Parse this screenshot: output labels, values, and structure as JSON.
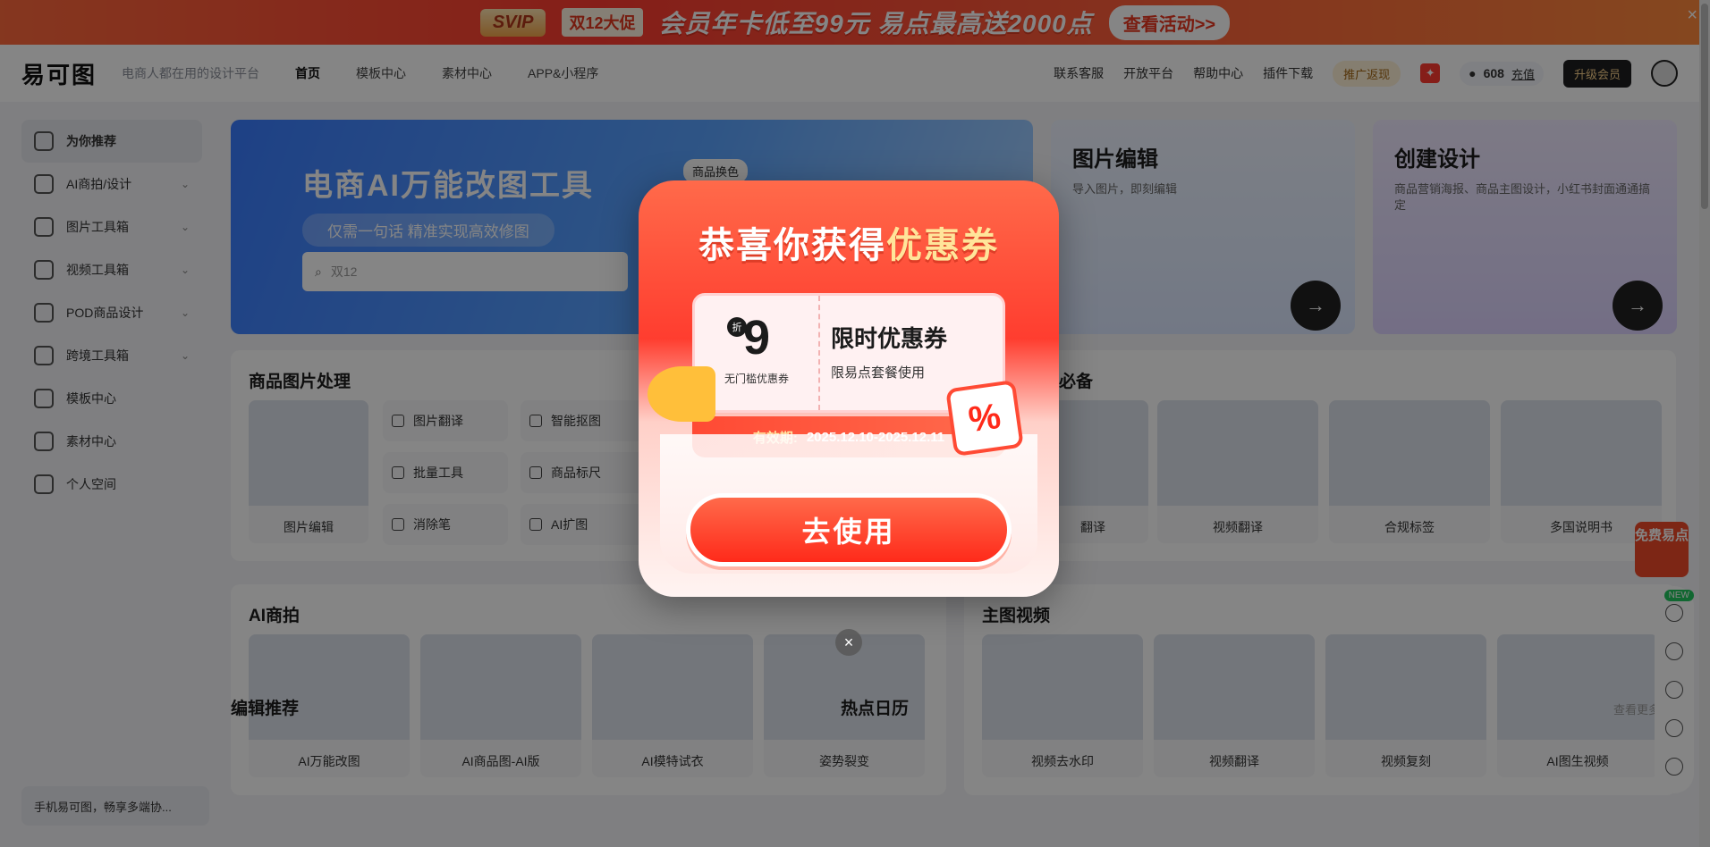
{
  "promo_banner": {
    "badge": "SVIP",
    "event_tag": "双12大促",
    "text": "会员年卡低至99元 易点最高送2000点",
    "cta": "查看活动>>",
    "close": "×"
  },
  "header": {
    "logo": "易可图",
    "slogan": "电商人都在用的设计平台",
    "nav": [
      "首页",
      "模板中心",
      "素材中心",
      "APP&小程序"
    ],
    "links": [
      "联系客服",
      "开放平台",
      "帮助中心",
      "插件下载"
    ],
    "promo_return": "推广返现",
    "points": "608",
    "recharge": "充值",
    "upgrade": "升级会员"
  },
  "sidebar": {
    "items": [
      {
        "label": "为你推荐",
        "active": true,
        "chevron": false
      },
      {
        "label": "AI商拍/设计",
        "active": false,
        "chevron": true
      },
      {
        "label": "图片工具箱",
        "active": false,
        "chevron": true
      },
      {
        "label": "视频工具箱",
        "active": false,
        "chevron": true
      },
      {
        "label": "POD商品设计",
        "active": false,
        "chevron": true
      },
      {
        "label": "跨境工具箱",
        "active": false,
        "chevron": true
      },
      {
        "label": "模板中心",
        "active": false,
        "chevron": false
      },
      {
        "label": "素材中心",
        "active": false,
        "chevron": false
      },
      {
        "label": "个人空间",
        "active": false,
        "chevron": false
      }
    ],
    "bottom": "手机易可图，畅享多端协..."
  },
  "hero": {
    "title": "电商AI万能改图工具",
    "subtitle": "仅需一句话 精准实现高效修图",
    "search_placeholder": "双12",
    "chip": "商品换色"
  },
  "cards": {
    "edit": {
      "title": "图片编辑",
      "desc": "导入图片，即刻编辑"
    },
    "design": {
      "title": "创建设计",
      "desc": "商品营销海报、商品主图设计，小红书封面通通搞定"
    }
  },
  "product_processing": {
    "title": "商品图片处理",
    "main_tile": "图片编辑",
    "tools": [
      "图片翻译",
      "智能抠图",
      "批量工具",
      "商品标尺",
      "消除笔",
      "AI扩图"
    ]
  },
  "cross_border": {
    "title_suffix": "必备",
    "tiles": [
      "翻译",
      "视频翻译",
      "合规标签",
      "多国说明书"
    ]
  },
  "ai_shoot": {
    "title": "AI商拍",
    "tiles": [
      "AI万能改图",
      "AI商品图-AI版",
      "AI模特试衣",
      "姿势裂变"
    ]
  },
  "main_video": {
    "title": "主图视频",
    "tiles": [
      "视频去水印",
      "视频翻译",
      "视频复刻",
      "AI图生视频"
    ]
  },
  "bottom": {
    "editor_pick": "编辑推荐",
    "hot_calendar": "热点日历",
    "see_more": "查看更多"
  },
  "float": {
    "free_points": "免费易点",
    "new_badge": "NEW"
  },
  "modal": {
    "title_a": "恭喜你获得",
    "title_b": "优惠券",
    "discount_num": "9",
    "discount_unit": "折",
    "discount_caption": "无门槛优惠券",
    "coupon_title": "限时优惠券",
    "coupon_desc": "限易点套餐使用",
    "validity_label": "有效期:",
    "validity_range": "2025.12.10-2025.12.11",
    "use_button": "去使用",
    "close": "×",
    "percent": "%"
  }
}
